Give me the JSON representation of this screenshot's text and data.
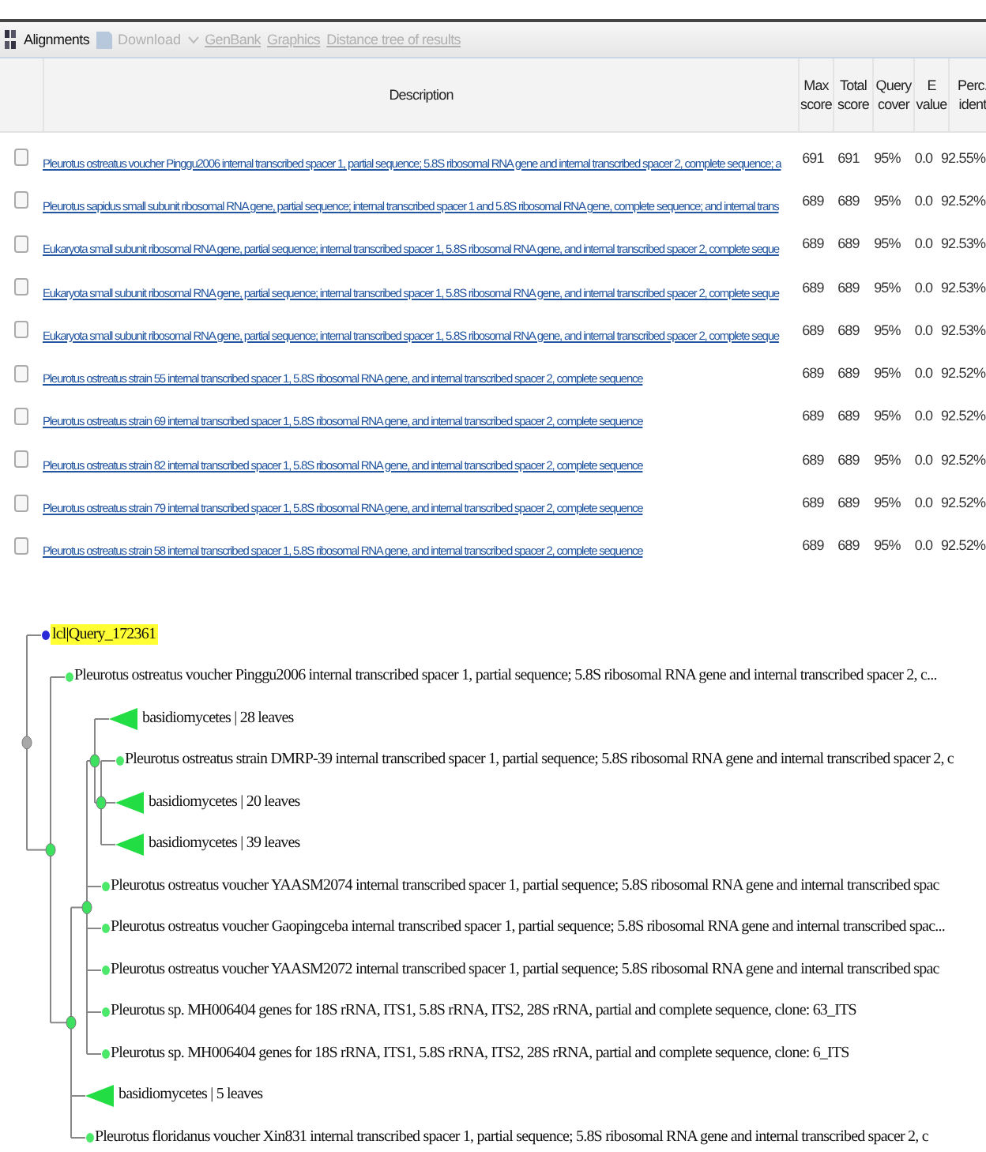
{
  "toolbar": {
    "title": "Alignments",
    "download": {
      "label": "Download",
      "disabled": true
    },
    "links": [
      {
        "label": "GenBank",
        "disabled": true
      },
      {
        "label": "Graphics",
        "disabled": true
      },
      {
        "label": "Distance tree of results",
        "disabled": true
      }
    ]
  },
  "table": {
    "columns": [
      "Description",
      "Max score",
      "Total score",
      "Query cover",
      "E value",
      "Perc. ident"
    ],
    "rows": [
      {
        "checked": false,
        "description": "Pleurotus ostreatus voucher Pinggu2006 internal transcribed spacer 1, partial sequence; 5.8S ribosomal RNA gene and internal transcribed spacer 2, complete sequence; a",
        "max_score": "691",
        "total_score": "691",
        "query_cover": "95%",
        "e_value": "0.0",
        "perc_ident": "92.55%"
      },
      {
        "checked": false,
        "description": "Pleurotus sapidus small subunit ribosomal RNA gene, partial sequence; internal transcribed spacer 1 and 5.8S ribosomal RNA gene, complete sequence; and internal trans",
        "max_score": "689",
        "total_score": "689",
        "query_cover": "95%",
        "e_value": "0.0",
        "perc_ident": "92.52%"
      },
      {
        "checked": false,
        "description": "Eukaryota small subunit ribosomal RNA gene, partial sequence; internal transcribed spacer 1, 5.8S ribosomal RNA gene, and internal transcribed spacer 2, complete seque",
        "max_score": "689",
        "total_score": "689",
        "query_cover": "95%",
        "e_value": "0.0",
        "perc_ident": "92.53%"
      },
      {
        "checked": false,
        "description": "Eukaryota small subunit ribosomal RNA gene, partial sequence; internal transcribed spacer 1, 5.8S ribosomal RNA gene, and internal transcribed spacer 2, complete seque",
        "max_score": "689",
        "total_score": "689",
        "query_cover": "95%",
        "e_value": "0.0",
        "perc_ident": "92.53%"
      },
      {
        "checked": false,
        "description": "Eukaryota small subunit ribosomal RNA gene, partial sequence; internal transcribed spacer 1, 5.8S ribosomal RNA gene, and internal transcribed spacer 2, complete seque",
        "max_score": "689",
        "total_score": "689",
        "query_cover": "95%",
        "e_value": "0.0",
        "perc_ident": "92.53%"
      },
      {
        "checked": false,
        "description": "Pleurotus ostreatus strain 55 internal transcribed spacer 1, 5.8S ribosomal RNA gene, and internal transcribed spacer 2, complete sequence",
        "max_score": "689",
        "total_score": "689",
        "query_cover": "95%",
        "e_value": "0.0",
        "perc_ident": "92.52%"
      },
      {
        "checked": false,
        "description": "Pleurotus ostreatus strain 69 internal transcribed spacer 1, 5.8S ribosomal RNA gene, and internal transcribed spacer 2, complete sequence",
        "max_score": "689",
        "total_score": "689",
        "query_cover": "95%",
        "e_value": "0.0",
        "perc_ident": "92.52%"
      },
      {
        "checked": false,
        "description": "Pleurotus ostreatus strain 82 internal transcribed spacer 1, 5.8S ribosomal RNA gene, and internal transcribed spacer 2, complete sequence",
        "max_score": "689",
        "total_score": "689",
        "query_cover": "95%",
        "e_value": "0.0",
        "perc_ident": "92.52%"
      },
      {
        "checked": false,
        "description": "Pleurotus ostreatus strain 79 internal transcribed spacer 1, 5.8S ribosomal RNA gene, and internal transcribed spacer 2, complete sequence",
        "max_score": "689",
        "total_score": "689",
        "query_cover": "95%",
        "e_value": "0.0",
        "perc_ident": "92.52%"
      },
      {
        "checked": false,
        "description": "Pleurotus ostreatus strain 58 internal transcribed spacer 1, 5.8S ribosomal RNA gene, and internal transcribed spacer 2, complete sequence",
        "max_score": "689",
        "total_score": "689",
        "query_cover": "95%",
        "e_value": "0.0",
        "perc_ident": "92.52%"
      }
    ]
  },
  "tree": {
    "kind": "root",
    "children": [
      {
        "kind": "query",
        "label": "lcl|Query_172361"
      },
      {
        "kind": "node",
        "children": [
          {
            "kind": "leaf",
            "label": "Pleurotus ostreatus voucher Pinggu2006 internal transcribed spacer 1, partial sequence; 5.8S ribosomal RNA gene and internal transcribed spacer 2, c..."
          },
          {
            "kind": "node",
            "children": [
              {
                "kind": "node",
                "children": [
                  {
                    "kind": "node",
                    "children": [
                      {
                        "kind": "collapsed",
                        "label": "basidiomycetes | 28 leaves"
                      },
                      {
                        "kind": "node",
                        "children": [
                          {
                            "kind": "leaf",
                            "label": "Pleurotus ostreatus strain DMRP-39 internal transcribed spacer 1, partial sequence; 5.8S ribosomal RNA gene and internal transcribed spacer 2, c"
                          },
                          {
                            "kind": "collapsed",
                            "label": "basidiomycetes | 20 leaves"
                          },
                          {
                            "kind": "collapsed",
                            "label": "basidiomycetes | 39 leaves"
                          }
                        ]
                      }
                    ]
                  },
                  {
                    "kind": "leaf",
                    "label": "Pleurotus ostreatus voucher YAASM2074 internal transcribed spacer 1, partial sequence; 5.8S ribosomal RNA gene and internal transcribed spac"
                  },
                  {
                    "kind": "leaf",
                    "label": "Pleurotus ostreatus voucher Gaopingceba internal transcribed spacer 1, partial sequence; 5.8S ribosomal RNA gene and internal transcribed spac..."
                  },
                  {
                    "kind": "leaf",
                    "label": "Pleurotus ostreatus voucher YAASM2072 internal transcribed spacer 1, partial sequence; 5.8S ribosomal RNA gene and internal transcribed spac"
                  },
                  {
                    "kind": "leaf",
                    "label": "Pleurotus sp. MH006404 genes for 18S rRNA, ITS1, 5.8S rRNA, ITS2, 28S rRNA, partial and complete sequence, clone: 63_ITS"
                  },
                  {
                    "kind": "leaf",
                    "label": "Pleurotus sp. MH006404 genes for 18S rRNA, ITS1, 5.8S rRNA, ITS2, 28S rRNA, partial and complete sequence, clone: 6_ITS"
                  }
                ]
              },
              {
                "kind": "collapsed",
                "label": "basidiomycetes | 5 leaves"
              },
              {
                "kind": "leaf",
                "label": "Pleurotus floridanus voucher Xin831 internal transcribed spacer 1, partial sequence; 5.8S ribosomal RNA gene and internal transcribed spacer 2, c"
              }
            ]
          }
        ]
      }
    ]
  }
}
